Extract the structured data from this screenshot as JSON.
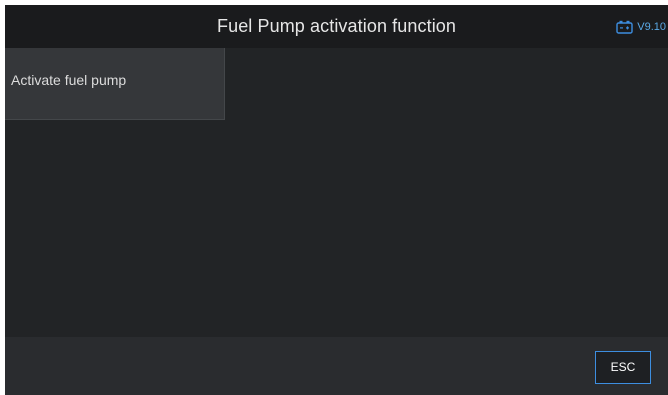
{
  "header": {
    "title": "Fuel Pump activation function",
    "version": "V9.10",
    "battery_icon": "battery-icon",
    "accent_color": "#3d8ee0"
  },
  "menu": {
    "items": [
      {
        "label": "Activate fuel pump"
      }
    ]
  },
  "footer": {
    "esc_label": "ESC"
  }
}
